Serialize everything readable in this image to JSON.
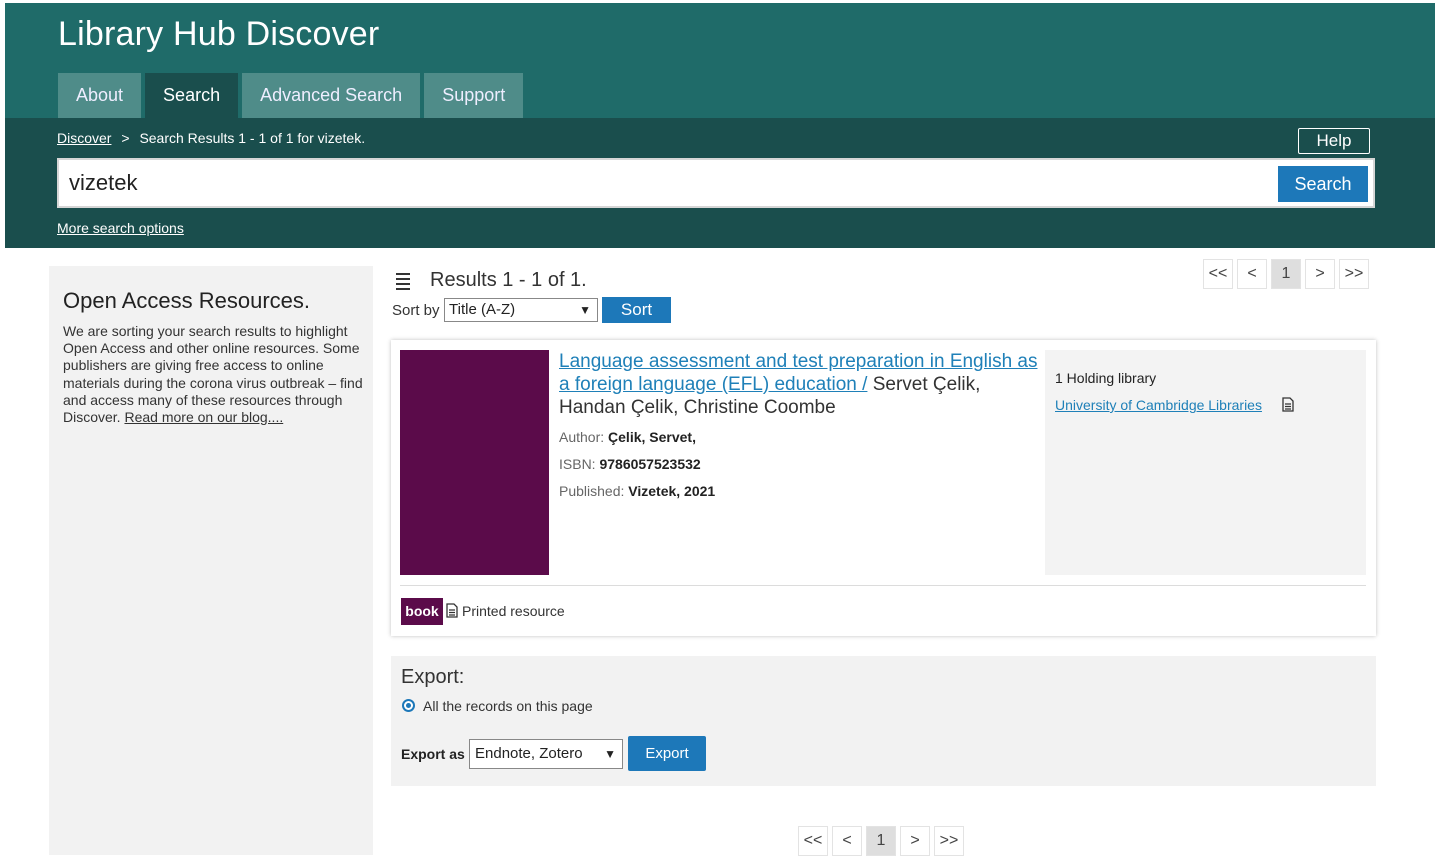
{
  "site": {
    "title": "Library Hub Discover"
  },
  "nav": {
    "tabs": [
      {
        "label": "About"
      },
      {
        "label": "Search"
      },
      {
        "label": "Advanced Search"
      },
      {
        "label": "Support"
      }
    ],
    "active": "Search"
  },
  "breadcrumb": {
    "root": "Discover",
    "separator": ">",
    "current": "Search Results 1 - 1 of 1 for vizetek."
  },
  "help_label": "Help",
  "search": {
    "query": "vizetek",
    "button_label": "Search",
    "more_options": "More search options"
  },
  "sidebar": {
    "title": "Open Access Resources.",
    "text": "We are sorting your search results to highlight Open Access and other online resources. Some publishers are giving free access to online materials during the corona virus outbreak – find and access many of these resources through Discover. ",
    "link": "Read more on our blog...."
  },
  "results": {
    "count_text": "Results 1 - 1 of 1.",
    "sort_label": "Sort by",
    "sort_value": "Title (A-Z)",
    "sort_button": "Sort"
  },
  "pager": {
    "first": "<<",
    "prev": "<",
    "page": "1",
    "next": ">",
    "last": ">>"
  },
  "record": {
    "title_link": "Language assessment and test preparation in English as a foreign language (EFL) education /",
    "title_rest": " Servet Çelik, Handan Çelik, Christine Coombe",
    "author_label": "Author:",
    "author": "Çelik, Servet,",
    "isbn_label": "ISBN:",
    "isbn": "9786057523532",
    "published_label": "Published:",
    "published": "Vizetek, 2021",
    "holdings_title": "1 Holding library",
    "holding_library": "University of Cambridge Libraries",
    "format_badge": "book",
    "format_text": "Printed resource",
    "cover_color": "#5b0b4a"
  },
  "export": {
    "title": "Export:",
    "radio_label": "All the records on this page",
    "export_as_label": "Export as",
    "format": "Endnote, Zotero",
    "button": "Export"
  },
  "colors": {
    "header": "#1f6b69",
    "search_band": "#1a4e4d",
    "accent": "#1d78b9",
    "link": "#1f80b8",
    "book": "#5b0b4a"
  }
}
